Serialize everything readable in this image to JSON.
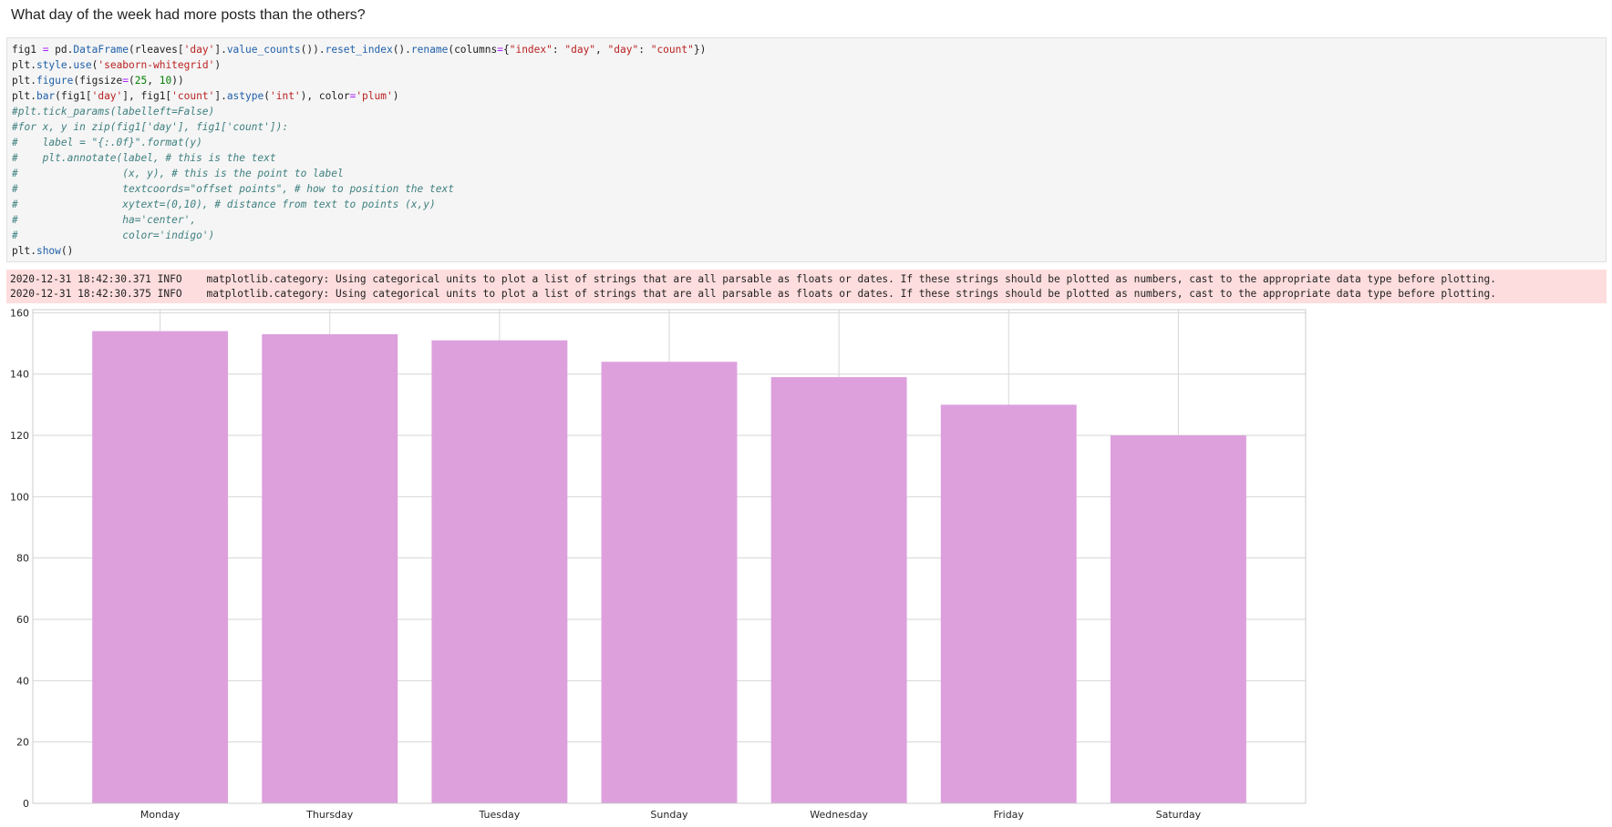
{
  "notebook": {
    "markdown_heading": "What day of the week had more posts than the others?",
    "code_lines": [
      [
        {
          "t": "fig1 "
        },
        {
          "t": "=",
          "c": "op"
        },
        {
          "t": " pd."
        },
        {
          "t": "DataFrame",
          "c": "fn"
        },
        {
          "t": "(rleaves["
        },
        {
          "t": "'day'",
          "c": "str"
        },
        {
          "t": "]."
        },
        {
          "t": "value_counts",
          "c": "fn"
        },
        {
          "t": "())."
        },
        {
          "t": "reset_index",
          "c": "fn"
        },
        {
          "t": "()."
        },
        {
          "t": "rename",
          "c": "fn"
        },
        {
          "t": "(columns"
        },
        {
          "t": "=",
          "c": "op"
        },
        {
          "t": "{"
        },
        {
          "t": "\"index\"",
          "c": "str"
        },
        {
          "t": ": "
        },
        {
          "t": "\"day\"",
          "c": "str"
        },
        {
          "t": ", "
        },
        {
          "t": "\"day\"",
          "c": "str"
        },
        {
          "t": ": "
        },
        {
          "t": "\"count\"",
          "c": "str"
        },
        {
          "t": "})"
        }
      ],
      [
        {
          "t": "plt."
        },
        {
          "t": "style",
          "c": "fn"
        },
        {
          "t": "."
        },
        {
          "t": "use",
          "c": "fn"
        },
        {
          "t": "("
        },
        {
          "t": "'seaborn-whitegrid'",
          "c": "str"
        },
        {
          "t": ")"
        }
      ],
      [
        {
          "t": "plt."
        },
        {
          "t": "figure",
          "c": "fn"
        },
        {
          "t": "(figsize"
        },
        {
          "t": "=",
          "c": "op"
        },
        {
          "t": "("
        },
        {
          "t": "25",
          "c": "num"
        },
        {
          "t": ", "
        },
        {
          "t": "10",
          "c": "num"
        },
        {
          "t": "))"
        }
      ],
      [
        {
          "t": "plt."
        },
        {
          "t": "bar",
          "c": "fn"
        },
        {
          "t": "(fig1["
        },
        {
          "t": "'day'",
          "c": "str"
        },
        {
          "t": "], fig1["
        },
        {
          "t": "'count'",
          "c": "str"
        },
        {
          "t": "]."
        },
        {
          "t": "astype",
          "c": "fn"
        },
        {
          "t": "("
        },
        {
          "t": "'int'",
          "c": "str"
        },
        {
          "t": "), color"
        },
        {
          "t": "=",
          "c": "op"
        },
        {
          "t": "'plum'",
          "c": "str"
        },
        {
          "t": ")"
        }
      ],
      [
        {
          "t": "#plt.tick_params(labelleft=False)",
          "c": "com"
        }
      ],
      [
        {
          "t": "#for x, y in zip(fig1['day'], fig1['count']):",
          "c": "com"
        }
      ],
      [
        {
          "t": "#    label = \"{:.0f}\".format(y)",
          "c": "com"
        }
      ],
      [
        {
          "t": "#    plt.annotate(label, # this is the text",
          "c": "com"
        }
      ],
      [
        {
          "t": "#                 (x, y), # this is the point to label",
          "c": "com"
        }
      ],
      [
        {
          "t": "#                 textcoords=\"offset points\", # how to position the text",
          "c": "com"
        }
      ],
      [
        {
          "t": "#                 xytext=(0,10), # distance from text to points (x,y)",
          "c": "com"
        }
      ],
      [
        {
          "t": "#                 ha='center',",
          "c": "com"
        }
      ],
      [
        {
          "t": "#                 color='indigo')",
          "c": "com"
        }
      ],
      [
        {
          "t": "plt."
        },
        {
          "t": "show",
          "c": "fn"
        },
        {
          "t": "()"
        }
      ]
    ],
    "stderr_lines": [
      "2020-12-31 18:42:30.371 INFO    matplotlib.category: Using categorical units to plot a list of strings that are all parsable as floats or dates. If these strings should be plotted as numbers, cast to the appropriate data type before plotting.",
      "2020-12-31 18:42:30.375 INFO    matplotlib.category: Using categorical units to plot a list of strings that are all parsable as floats or dates. If these strings should be plotted as numbers, cast to the appropriate data type before plotting."
    ]
  },
  "colors": {
    "bar": "#dda0dd",
    "grid": "#d6d6d6",
    "axes_border": "#cccccc",
    "stderr_bg": "#fddddd",
    "code_bg": "#f5f5f5"
  },
  "chart_data": {
    "type": "bar",
    "categories": [
      "Monday",
      "Thursday",
      "Tuesday",
      "Sunday",
      "Wednesday",
      "Friday",
      "Saturday"
    ],
    "values": [
      154,
      153,
      151,
      144,
      139,
      130,
      120
    ],
    "title": "",
    "xlabel": "",
    "ylabel": "",
    "ylim": [
      0,
      161
    ],
    "yticks": [
      0,
      20,
      40,
      60,
      80,
      100,
      120,
      140,
      160
    ],
    "grid": true,
    "legend": "none"
  }
}
